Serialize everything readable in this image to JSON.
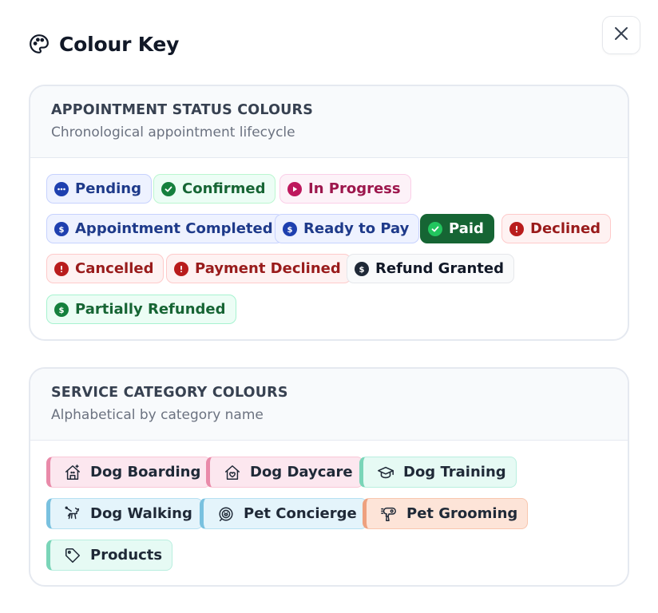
{
  "modal": {
    "title": "Colour Key",
    "title_icon": "palette-icon",
    "close_icon": "close-icon"
  },
  "appointment_status": {
    "title": "APPOINTMENT STATUS COLOURS",
    "subtitle": "Chronological appointment lifecycle",
    "items": [
      {
        "label": "Pending",
        "icon": "more-dots-icon",
        "color": "#1e40af"
      },
      {
        "label": "Confirmed",
        "icon": "check-circle-icon",
        "color": "#15803d"
      },
      {
        "label": "In Progress",
        "icon": "play-circle-icon",
        "color": "#be185d"
      },
      {
        "label": "Appointment Completed",
        "icon": "dollar-circle-icon",
        "color": "#1e40af"
      },
      {
        "label": "Ready to Pay",
        "icon": "dollar-circle-icon",
        "color": "#1e40af"
      },
      {
        "label": "Paid",
        "icon": "check-circle-icon",
        "color": "#166534"
      },
      {
        "label": "Declined",
        "icon": "alert-circle-icon",
        "color": "#b91c1c"
      },
      {
        "label": "Cancelled",
        "icon": "alert-circle-icon",
        "color": "#b91c1c"
      },
      {
        "label": "Payment Declined",
        "icon": "alert-circle-icon",
        "color": "#b91c1c"
      },
      {
        "label": "Refund Granted",
        "icon": "dollar-circle-icon",
        "color": "#1f2937"
      },
      {
        "label": "Partially Refunded",
        "icon": "dollar-circle-icon",
        "color": "#15803d"
      }
    ]
  },
  "service_category": {
    "title": "SERVICE CATEGORY COLOURS",
    "subtitle": "Alphabetical by category name",
    "items": [
      {
        "label": "Dog Boarding",
        "icon": "dog-house-icon",
        "color": "#fce7ef"
      },
      {
        "label": "Dog Daycare",
        "icon": "dog-house-heart-icon",
        "color": "#fce7ef"
      },
      {
        "label": "Dog Training",
        "icon": "graduation-cap-icon",
        "color": "#e6faf4"
      },
      {
        "label": "Dog Walking",
        "icon": "dog-walking-icon",
        "color": "#e4f4fb"
      },
      {
        "label": "Pet Concierge",
        "icon": "concierge-icon",
        "color": "#e4f4fb"
      },
      {
        "label": "Pet Grooming",
        "icon": "hair-dryer-icon",
        "color": "#fde4d8"
      },
      {
        "label": "Products",
        "icon": "tag-icon",
        "color": "#e6faf4"
      }
    ]
  }
}
